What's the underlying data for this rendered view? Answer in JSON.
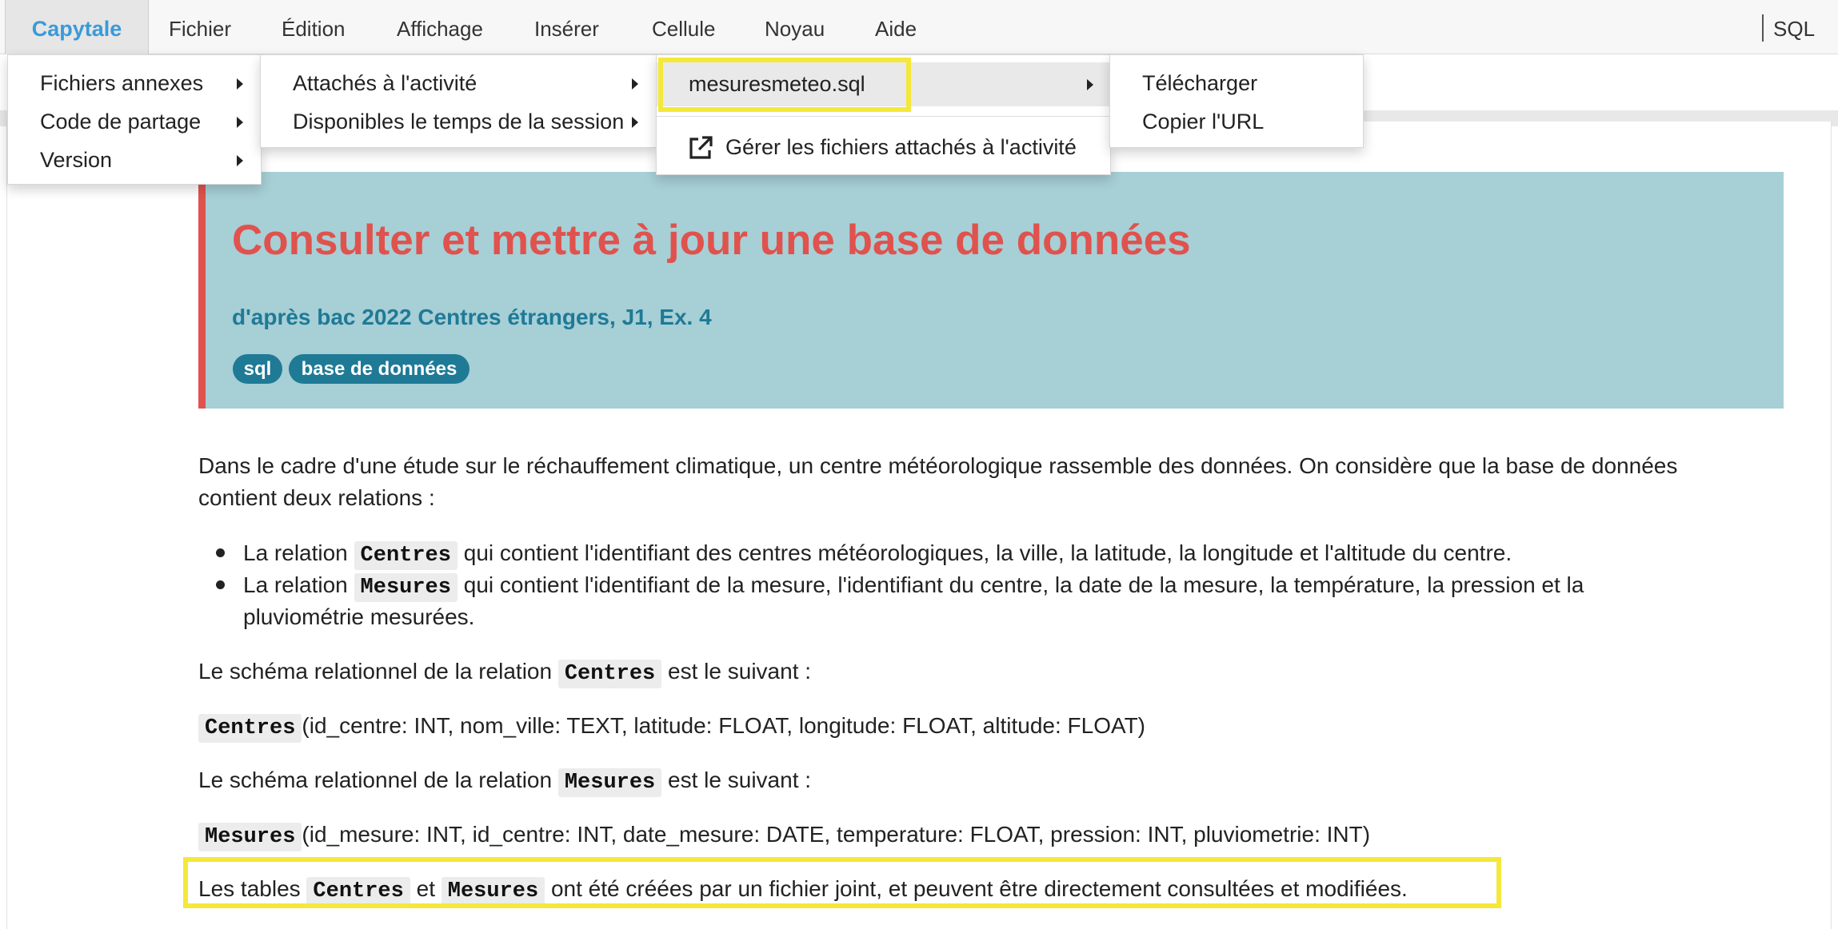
{
  "menubar": {
    "brand": "Capytale",
    "items": [
      "Fichier",
      "Édition",
      "Affichage",
      "Insérer",
      "Cellule",
      "Noyau",
      "Aide"
    ],
    "kernel_label": "SQL"
  },
  "menu_level1": {
    "items": [
      "Fichiers annexes",
      "Code de partage",
      "Version"
    ]
  },
  "menu_level2": {
    "items": [
      "Attachés à l'activité",
      "Disponibles le temps de la session"
    ]
  },
  "menu_level3": {
    "file_item": "mesuresmeteo.sql",
    "manage_item": "Gérer les fichiers attachés à l'activité"
  },
  "menu_level4": {
    "items": [
      "Télécharger",
      "Copier l'URL"
    ]
  },
  "header": {
    "title": "Consulter et mettre à jour une base de données",
    "subtitle": "d'après bac 2022 Centres étrangers, J1, Ex. 4",
    "tags": [
      "sql",
      "base de données"
    ]
  },
  "content": {
    "intro_line1": "Dans le cadre d'une étude sur le réchauffement climatique, un centre météorologique rassemble des données. On considère que la base de données",
    "intro_line2": "contient deux relations :",
    "bullet1_pre": "La relation",
    "bullet1_code": "Centres",
    "bullet1_post": "qui contient l'identifiant des centres météorologiques, la ville, la latitude, la longitude et l'altitude du centre.",
    "bullet2_pre": "La relation",
    "bullet2_code": "Mesures",
    "bullet2_post": "qui contient l'identifiant de la mesure, l'identifiant du centre, la date de la mesure, la température, la pression et la",
    "bullet2_cont": "pluviométrie mesurées.",
    "schema1_pre": "Le schéma relationnel de la relation",
    "schema1_code": "Centres",
    "schema1_post": "est le suivant :",
    "schema1_def_code": "Centres",
    "schema1_def": "(id_centre: INT, nom_ville: TEXT, latitude: FLOAT, longitude: FLOAT, altitude: FLOAT)",
    "schema2_pre": "Le schéma relationnel de la relation",
    "schema2_code": "Mesures",
    "schema2_post": "est le suivant :",
    "schema2_def_code": "Mesures",
    "schema2_def": "(id_mesure: INT, id_centre: INT, date_mesure: DATE, temperature: FLOAT, pression: INT, pluviometrie: INT)",
    "final_pre": "Les tables",
    "final_code1": "Centres",
    "final_mid": "et",
    "final_code2": "Mesures",
    "final_post": "ont été créées par un fichier joint, et peuvent être directement consultées et modifiées."
  },
  "colors": {
    "brand": "#3a9ad9",
    "title_red": "#e0524d",
    "header_bg": "#a7cfd6",
    "tag_bg": "#1f7a96",
    "highlight": "#f4e83a"
  }
}
